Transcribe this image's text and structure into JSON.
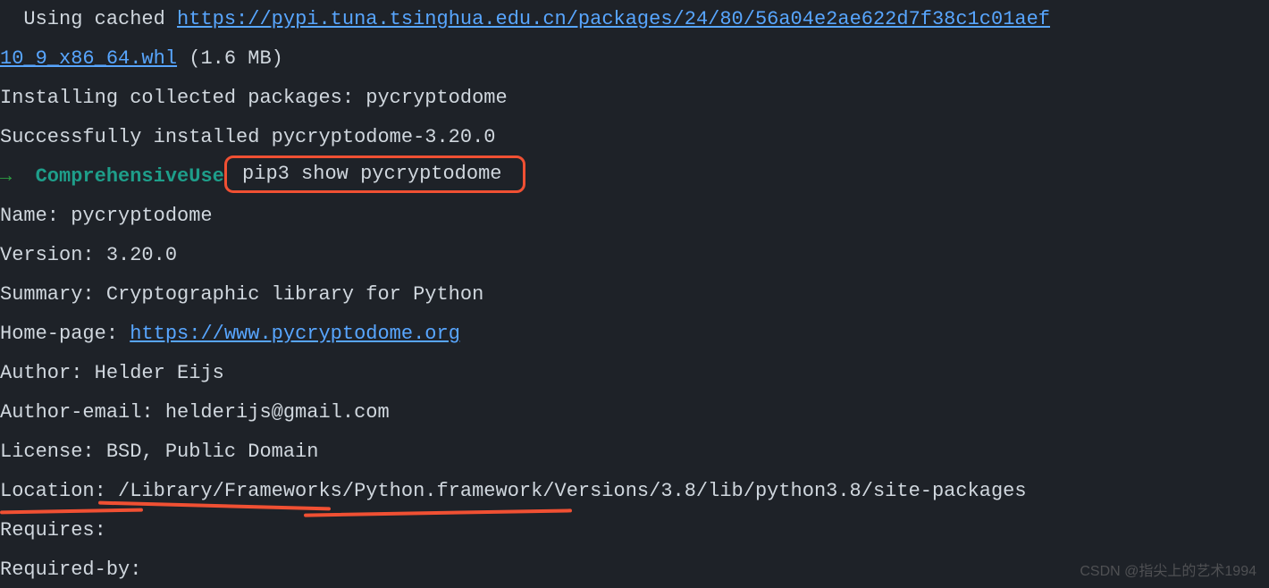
{
  "line1": {
    "prefix": "  Using cached ",
    "url": "https://pypi.tuna.tsinghua.edu.cn/packages/24/80/56a04e2ae622d7f38c1c01aef",
    "url_wrap": "10_9_x86_64.whl",
    "size": " (1.6 MB)"
  },
  "installing": "Installing collected packages: pycryptodome",
  "success": "Successfully installed pycryptodome-3.20.0",
  "prompt": {
    "arrow": "→  ",
    "context": "ComprehensiveUse",
    "command": " pip3 show pycryptodome "
  },
  "info": {
    "name": "Name: pycryptodome",
    "version": "Version: 3.20.0",
    "summary": "Summary: Cryptographic library for Python",
    "homepage_label": "Home-page: ",
    "homepage_url": "https://www.pycryptodome.org",
    "author": "Author: Helder Eijs",
    "author_email": "Author-email: helderijs@gmail.com",
    "license": "License: BSD, Public Domain",
    "location": "Location: /Library/Frameworks/Python.framework/Versions/3.8/lib/python3.8/site-packages",
    "requires": "Requires:",
    "required_by": "Required-by:"
  },
  "watermark": "CSDN @指尖上的艺术1994"
}
